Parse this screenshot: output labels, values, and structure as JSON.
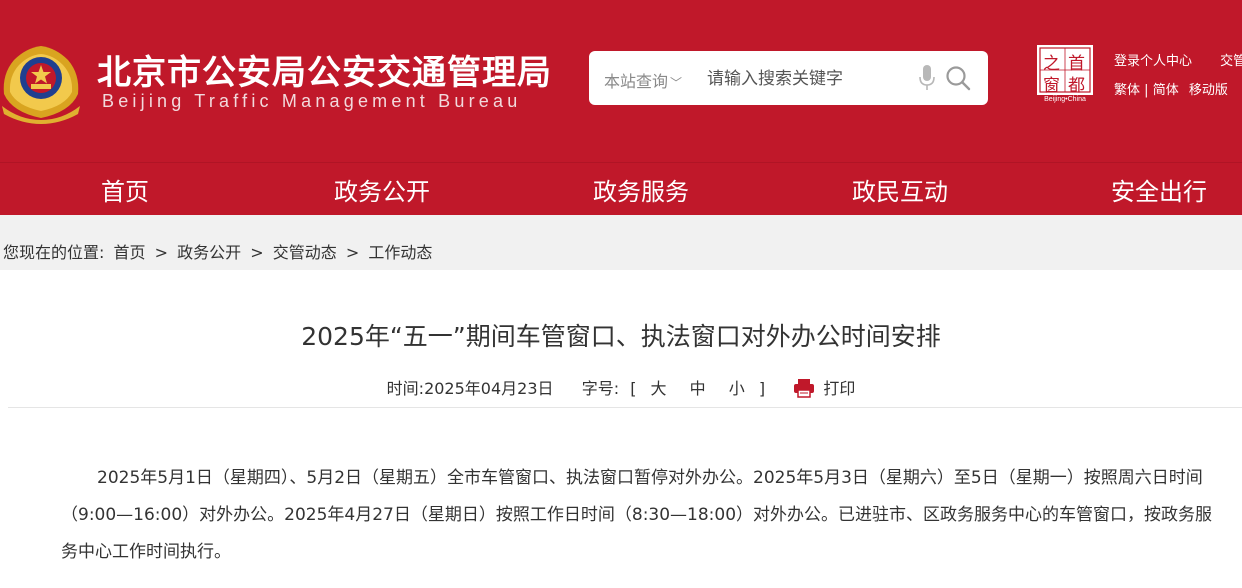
{
  "header": {
    "site_name_cn": "北京市公安局公安交通管理局",
    "site_name_en": "Beijing Traffic Management Bureau",
    "search": {
      "scope": "本站查询",
      "placeholder": "请输入搜索关键字"
    },
    "capital_logo": {
      "chars": [
        "之",
        "首",
        "窗",
        "都"
      ],
      "caption": "Beijing•China"
    },
    "links_row1": [
      "登录个人中心",
      "交管"
    ],
    "links_row2": [
      "繁体",
      "简体",
      "移动版"
    ]
  },
  "nav": [
    "首页",
    "政务公开",
    "政务服务",
    "政民互动",
    "安全出行"
  ],
  "breadcrumb": {
    "prefix": "您现在的位置:",
    "items": [
      "首页",
      "政务公开",
      "交管动态",
      "工作动态"
    ],
    "separator": ">"
  },
  "article": {
    "title": "2025年“五一”期间车管窗口、执法窗口对外办公时间安排",
    "time_label": "时间:",
    "date": "2025年04月23日",
    "font_label": "字号:",
    "font_sizes": [
      "大",
      "中",
      "小"
    ],
    "bracket_open": "[",
    "bracket_close": "]",
    "print_label": "打印",
    "body": "2025年5月1日（星期四）、5月2日（星期五）全市车管窗口、执法窗口暂停对外办公。2025年5月3日（星期六）至5日（星期一）按照周六日时间（9:00—16:00）对外办公。2025年4月27日（星期日）按照工作日时间（8:30—18:00）对外办公。已进驻市、区政务服务中心的车管窗口，按政务服务中心工作时间执行。"
  },
  "colors": {
    "brand_red": "#c0182a",
    "breadcrumb_bg": "#f1f1f1",
    "print_icon": "#c0182a"
  }
}
